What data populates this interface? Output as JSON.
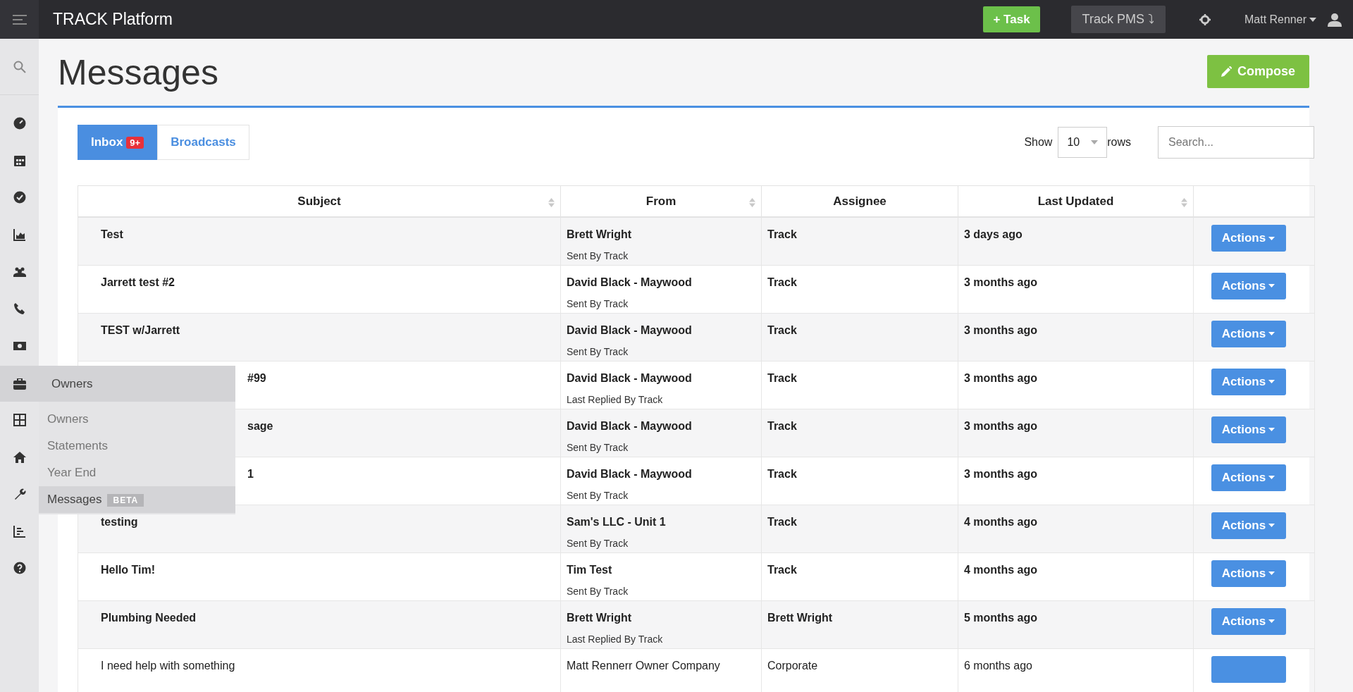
{
  "topbar": {
    "title": "TRACK Platform",
    "task_button": "+ Task",
    "pms_button": "Track PMS ⤵",
    "user_name": "Matt Renner"
  },
  "sidebar_menu": {
    "title": "Owners",
    "items": [
      {
        "label": "Owners",
        "selected": false
      },
      {
        "label": "Statements",
        "selected": false
      },
      {
        "label": "Year End",
        "selected": false
      },
      {
        "label": "Messages",
        "selected": true,
        "badge": "BETA"
      }
    ]
  },
  "page": {
    "title": "Messages",
    "compose_button": "Compose"
  },
  "tabs": [
    {
      "label": "Inbox",
      "badge": "9+",
      "selected": true
    },
    {
      "label": "Broadcasts",
      "selected": false
    }
  ],
  "rows_control": {
    "before": "Show",
    "value": "10",
    "after": "rows"
  },
  "search": {
    "placeholder": "Search..."
  },
  "table": {
    "columns": [
      {
        "label": "Subject",
        "sortable": true
      },
      {
        "label": "From",
        "sortable": true
      },
      {
        "label": "Assignee",
        "sortable": false
      },
      {
        "label": "Last Updated",
        "sortable": true
      },
      {
        "sortable": false
      }
    ],
    "rows": [
      {
        "subject": "Test",
        "from": "Brett Wright",
        "from_note": "Sent By Track",
        "assignee": "Track",
        "updated": "3 days ago",
        "action": "Actions"
      },
      {
        "subject": "Jarrett test #2",
        "from": "David Black - Maywood",
        "from_note": "Sent By Track",
        "assignee": "Track",
        "updated": "3 months ago",
        "action": "Actions"
      },
      {
        "subject": "TEST w/Jarrett",
        "from": "David Black - Maywood",
        "from_note": "Sent By Track",
        "assignee": "Track",
        "updated": "3 months ago",
        "action": "Actions"
      },
      {
        "subject": "#99",
        "covered_by_menu": true,
        "from": "David Black - Maywood",
        "from_note": "Last Replied By Track",
        "assignee": "Track",
        "updated": "3 months ago",
        "action": "Actions"
      },
      {
        "subject": "sage",
        "covered_by_menu": true,
        "from": "David Black - Maywood",
        "from_note": "Sent By Track",
        "assignee": "Track",
        "updated": "3 months ago",
        "action": "Actions"
      },
      {
        "subject": "1",
        "covered_by_menu": true,
        "from": "David Black - Maywood",
        "from_note": "Sent By Track",
        "assignee": "Track",
        "updated": "3 months ago",
        "action": "Actions"
      },
      {
        "subject": "testing",
        "from": "Sam's LLC - Unit 1",
        "from_note": "Sent By Track",
        "assignee": "Track",
        "updated": "4 months ago",
        "action": "Actions"
      },
      {
        "subject": "Hello Tim!",
        "from": "Tim Test",
        "from_note": "Sent By Track",
        "assignee": "Track",
        "updated": "4 months ago",
        "action": "Actions"
      },
      {
        "subject": "Plumbing Needed",
        "from": "Brett Wright",
        "from_note": "Last Replied By Track",
        "assignee": "Brett Wright",
        "updated": "5 months ago",
        "action": "Actions"
      },
      {
        "subject": "I need help with something",
        "unread": false,
        "from": "Matt Rennerr Owner Company",
        "assignee": "Corporate",
        "updated": "6 months ago"
      }
    ]
  }
}
